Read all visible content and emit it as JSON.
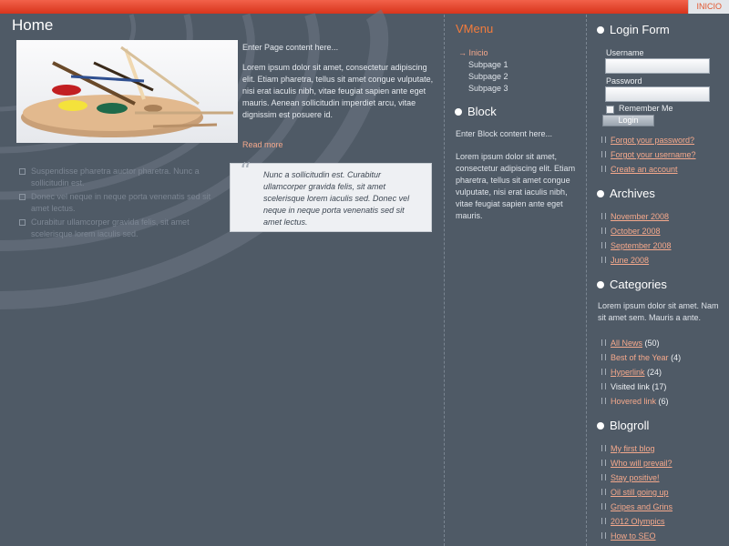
{
  "topnav": {
    "label": "INICIO"
  },
  "page": {
    "title": "Home",
    "intro": "Enter Page content here...",
    "body": "Lorem ipsum dolor sit amet, consectetur adipiscing elit. Etiam pharetra, tellus sit amet congue vulputate, nisi erat iaculis nibh, vitae feugiat sapien ante eget mauris. Aenean sollicitudin imperdiet arcu, vitae dignissim est posuere id.",
    "read_more": "Read more",
    "bullets": [
      "Suspendisse pharetra auctor pharetra. Nunc a sollicitudin est.",
      "Donec vel neque in neque porta venenatis sed sit amet lectus.",
      "Curabitur ullamcorper gravida felis, sit amet scelerisque lorem iaculis sed."
    ],
    "quote": "Nunc a sollicitudin est. Curabitur ullamcorper gravida felis, sit amet scelerisque lorem iaculis sed. Donec vel neque in neque porta venenatis sed sit amet lectus.",
    "quote_mark": "“"
  },
  "vmenu": {
    "title": "VMenu",
    "items": [
      {
        "label": "→ Inicio"
      },
      {
        "label": "Subpage 1"
      },
      {
        "label": "Subpage 2"
      },
      {
        "label": "Subpage 3"
      }
    ]
  },
  "block": {
    "title": "Block",
    "intro": "Enter Block content here...",
    "body": "Lorem ipsum dolor sit amet, consectetur adipiscing elit. Etiam pharetra, tellus sit amet congue vulputate, nisi erat iaculis nibh, vitae feugiat sapien ante eget mauris."
  },
  "login": {
    "title": "Login Form",
    "username_label": "Username",
    "password_label": "Password",
    "remember_label": "Remember Me",
    "button": "Login",
    "links": [
      "Forgot your password?",
      "Forgot your username?",
      "Create an account"
    ]
  },
  "archives": {
    "title": "Archives",
    "items": [
      "November 2008",
      "October 2008",
      "September 2008",
      "June 2008"
    ]
  },
  "categories": {
    "title": "Categories",
    "text": "Lorem ipsum dolor sit amet. Nam sit amet sem. Mauris a ante.",
    "items": [
      {
        "label": "All News",
        "count": "(50)"
      },
      {
        "label": "Best of the Year",
        "count": "(4)"
      },
      {
        "label": "Hyperlink",
        "count": "(24)"
      },
      {
        "label": "Visited link",
        "count": "(17)"
      },
      {
        "label": "Hovered link",
        "count": "(6)"
      }
    ]
  },
  "blogroll": {
    "title": "Blogroll",
    "items": [
      "My first blog",
      "Who will prevail?",
      "Stay positive!",
      "Oil still going up",
      "Gripes and Grins",
      "2012 Olympics",
      "How to SEO"
    ]
  },
  "colors": {
    "accent": "#f47c3c",
    "link": "#f5a98c",
    "background": "#4f5a66",
    "topbar": "#e0412a"
  }
}
